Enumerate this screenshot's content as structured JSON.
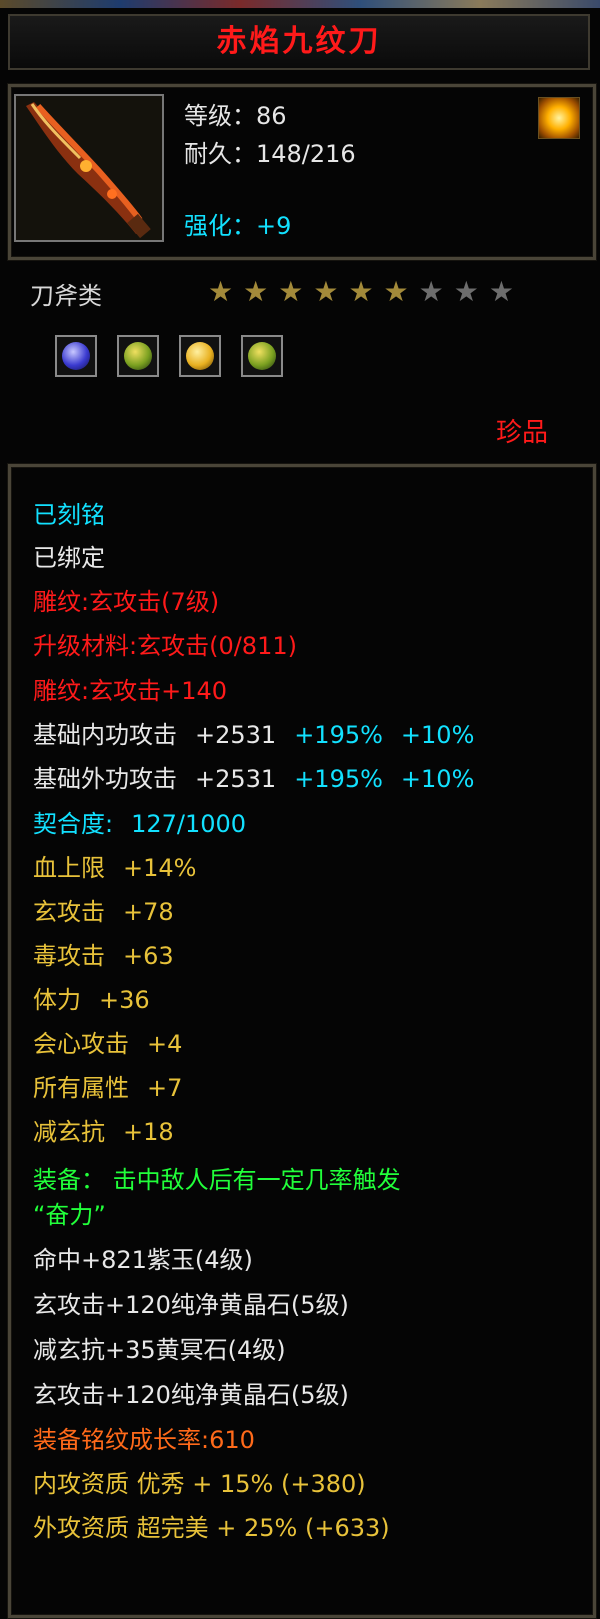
{
  "item": {
    "name": "赤焰九纹刀",
    "level_label": "等级：86",
    "durability_label": "耐久：148/216",
    "enhance_label": "强化：+9",
    "category": "刀斧类",
    "stars_filled": 6,
    "stars_total": 9,
    "rarity": "珍品"
  },
  "gems": [
    {
      "name": "purple-gem-icon",
      "color": "#3a3ad0"
    },
    {
      "name": "green-gold-gem-icon",
      "color": "#7aa020"
    },
    {
      "name": "yellow-gem-icon",
      "color": "#e8b020"
    },
    {
      "name": "green-gold-gem-icon",
      "color": "#7aa020"
    }
  ],
  "attributes": {
    "engraved": "已刻铭",
    "bound": "已绑定",
    "carving_level": "雕纹:玄攻击(7级)",
    "upgrade_material": "升级材料:玄攻击(0/811)",
    "carving_bonus": "雕纹:玄攻击+140",
    "inner_attack": {
      "label": "基础内功攻击",
      "flat": "+2531",
      "pct1": "+195%",
      "pct2": "+10%"
    },
    "outer_attack": {
      "label": "基础外功攻击",
      "flat": "+2531",
      "pct1": "+195%",
      "pct2": "+10%"
    },
    "affinity": {
      "label": "契合度:",
      "value": "127/1000"
    },
    "stats": [
      {
        "label": "血上限",
        "value": "+14%"
      },
      {
        "label": "玄攻击",
        "value": "+78"
      },
      {
        "label": "毒攻击",
        "value": "+63"
      },
      {
        "label": "体力",
        "value": "+36"
      },
      {
        "label": "会心攻击",
        "value": "+4"
      },
      {
        "label": "所有属性",
        "value": "+7"
      },
      {
        "label": "减玄抗",
        "value": "+18"
      }
    ],
    "equip_effect_line1": "装备：  击中敌人后有一定几率触发",
    "equip_effect_line2": "“奋力”",
    "sockets": [
      "命中+821紫玉(4级)",
      "玄攻击+120纯净黄晶石(5级)",
      "减玄抗+35黄冥石(4级)",
      "玄攻击+120纯净黄晶石(5级)"
    ],
    "growth": "装备铭纹成长率:610",
    "inner_quality": "内攻资质 优秀 + 15% (+380)",
    "outer_quality": "外攻资质 超完美 + 25% (+633)"
  },
  "colors": {
    "title_red": "#ff1a1a",
    "cyan": "#12e1ff",
    "yellow": "#e8c23a",
    "green": "#21ff3a",
    "orange": "#ff6a1a"
  }
}
